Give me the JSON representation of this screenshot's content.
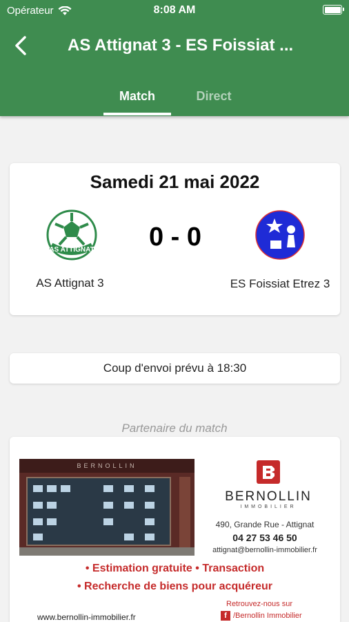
{
  "status_bar": {
    "carrier": "Opérateur",
    "time": "8:08 AM"
  },
  "header": {
    "title": "AS Attignat 3 - ES Foissiat ..."
  },
  "tabs": [
    {
      "label": "Match",
      "active": true
    },
    {
      "label": "Direct",
      "active": false
    }
  ],
  "match": {
    "date": "Samedi 21 mai 2022",
    "score": "0 - 0",
    "home_team": "AS Attignat 3",
    "away_team": "ES Foissiat Etrez 3",
    "home_logo_text": "AS ATTIGNAT",
    "kickoff": "Coup d'envoi prévu à 18:30"
  },
  "partner": {
    "label": "Partenaire du match",
    "shop_sign": "BERNOLLIN",
    "brand_name": "BERNOLLIN",
    "brand_sub": "IMMOBILIER",
    "address": "490, Grande Rue - Attignat",
    "phone": "04 27 53 46 50",
    "email": "attignat@bernollin-immobilier.fr",
    "services_line1": "• Estimation gratuite • Transaction",
    "services_line2": "• Recherche de biens pour acquéreur",
    "website": "www.bernollin-immobilier.fr",
    "facebook_text": "Retrouvez-nous sur",
    "facebook_page": "/Bernollin Immobilier"
  },
  "colors": {
    "header": "#3f8c50",
    "brand_red": "#c52a2a",
    "away_logo": "#1f2bd6"
  }
}
